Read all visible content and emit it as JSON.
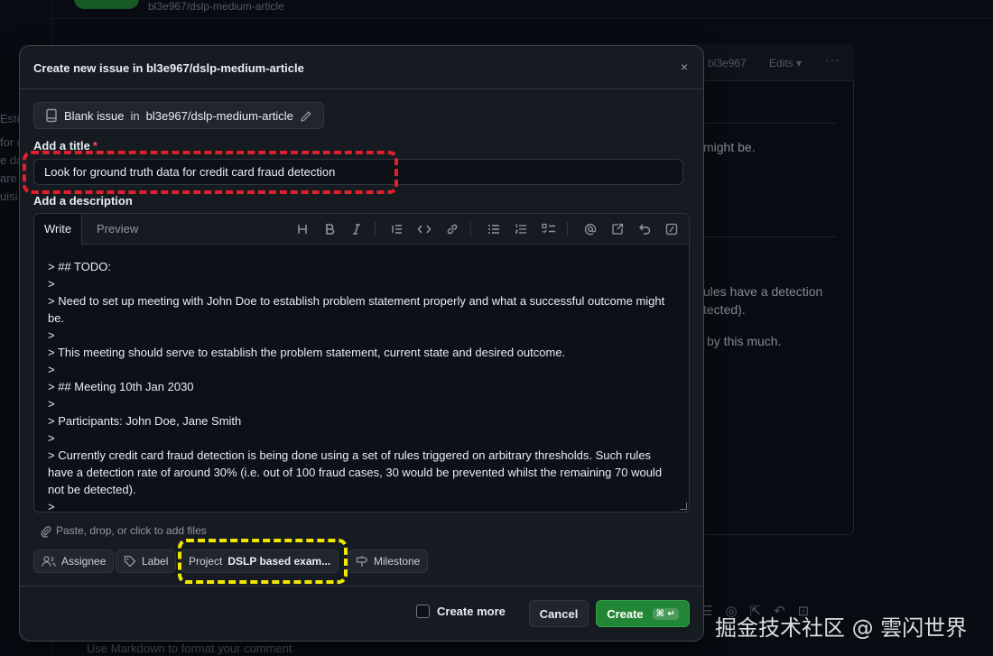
{
  "background": {
    "repo_name": "bl3e967/dslp-medium-article",
    "left_fragments": [
      "Estin",
      "for c",
      "e da",
      "are",
      "uisi"
    ],
    "comment_author": "bl3e967",
    "edits_label": "Edits",
    "more_label": "···",
    "text_fragments": [
      "might be.",
      "ules have a detection",
      "tected).",
      "by this much."
    ],
    "markdown_hint": "Use Markdown to format your comment",
    "toolbar_glyphs": "☰◎⇱↶⊡"
  },
  "watermark": "掘金技术社区 @ 雲闪世界",
  "modal": {
    "title": "Create new issue in bl3e967/dslp-medium-article",
    "close_glyph": "×",
    "template": {
      "name": "Blank issue",
      "in_word": "in",
      "repo": "bl3e967/dslp-medium-article"
    },
    "title_label": "Add a title",
    "required_mark": "*",
    "title_value": "Look for ground truth data for credit card fraud detection",
    "description_label": "Add a description",
    "tabs": [
      {
        "label": "Write",
        "active": true
      },
      {
        "label": "Preview",
        "active": false
      }
    ],
    "toolbar_tools": [
      "heading",
      "bold",
      "italic",
      "quote",
      "code",
      "link",
      "bulleted-list",
      "numbered-list",
      "task-list",
      "mention",
      "reference",
      "undo",
      "slash-commands"
    ],
    "description_lines": [
      "> ## TODO:",
      ">",
      "> Need to set up meeting with John Doe to establish problem statement properly and what a successful outcome might be.",
      ">",
      "> This meeting should serve to establish the problem statement, current state and desired outcome.",
      ">",
      "> ## Meeting 10th Jan 2030",
      ">",
      "> Participants: John Doe, Jane Smith",
      ">",
      "> Currently credit card fraud detection is being done using a set of rules triggered on arbitrary thresholds. Such rules have a detection rate of around 30% (i.e. out of 100 fraud cases, 30 would be prevented whilst the remaining 70 would not be detected).",
      ">"
    ],
    "attach_label": "Paste, drop, or click to add files",
    "metadata": {
      "assignee": "Assignee",
      "label": "Label",
      "project_prefix": "Project",
      "project_value": "DSLP based exam...",
      "milestone": "Milestone"
    },
    "footer": {
      "create_more": "Create more",
      "cancel": "Cancel",
      "create": "Create",
      "create_shortcut": "⌘ ↵"
    }
  },
  "colors": {
    "accent_green": "#238636",
    "highlight_red": "#e0202a",
    "highlight_yellow": "#f3e700"
  }
}
